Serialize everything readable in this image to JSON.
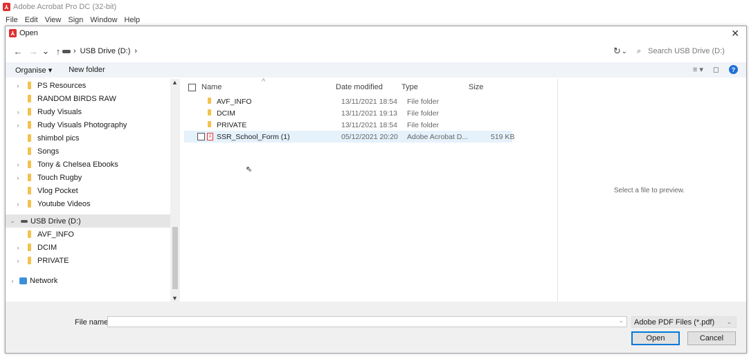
{
  "app": {
    "title": "Adobe Acrobat Pro DC (32-bit)",
    "menu": [
      "File",
      "Edit",
      "View",
      "Sign",
      "Window",
      "Help"
    ]
  },
  "dialog": {
    "title": "Open",
    "close_glyph": "✕",
    "nav": {
      "back": "←",
      "forward": "→",
      "recent": "⌄",
      "up": "↑"
    },
    "address": {
      "separator": "›",
      "location": "USB Drive (D:)",
      "tail_arrow": "›",
      "dropdown": "⌄"
    },
    "refresh_glyph": "↻",
    "search": {
      "icon": "⌕",
      "placeholder": "Search USB Drive (D:)"
    },
    "command_bar": {
      "organise": "Organise ▾",
      "new_folder": "New folder",
      "view_glyph": "≡ ▾",
      "pane_glyph": "◻",
      "help_glyph": "?"
    },
    "nav_pane": {
      "items": [
        {
          "label": "PS Resources",
          "expand": "›",
          "kind": "folder"
        },
        {
          "label": "RANDOM BIRDS RAW",
          "expand": "",
          "kind": "folder"
        },
        {
          "label": "Rudy Visuals",
          "expand": "›",
          "kind": "folder"
        },
        {
          "label": "Rudy Visuals Photography",
          "expand": "›",
          "kind": "folder"
        },
        {
          "label": "shimbol pics",
          "expand": "",
          "kind": "folder"
        },
        {
          "label": "Songs",
          "expand": "",
          "kind": "folder"
        },
        {
          "label": "Tony & Chelsea Ebooks",
          "expand": "›",
          "kind": "folder"
        },
        {
          "label": "Touch Rugby",
          "expand": "›",
          "kind": "folder"
        },
        {
          "label": "Vlog Pocket",
          "expand": "",
          "kind": "folder"
        },
        {
          "label": "Youtube Videos",
          "expand": "›",
          "kind": "folder"
        },
        {
          "label": "USB Drive (D:)",
          "expand": "⌄",
          "kind": "drive"
        },
        {
          "label": "AVF_INFO",
          "expand": "",
          "kind": "folder"
        },
        {
          "label": "DCIM",
          "expand": "›",
          "kind": "folder"
        },
        {
          "label": "PRIVATE",
          "expand": "›",
          "kind": "folder"
        },
        {
          "label": "Network",
          "expand": "›",
          "kind": "network"
        }
      ],
      "scroll_up": "▲",
      "scroll_down": "▼"
    },
    "file_list": {
      "columns": {
        "name": "Name",
        "date": "Date modified",
        "type": "Type",
        "size": "Size"
      },
      "sort_glyph": "^",
      "rows": [
        {
          "name": "AVF_INFO",
          "date": "13/11/2021 18:54",
          "type": "File folder",
          "size": "",
          "kind": "folder"
        },
        {
          "name": "DCIM",
          "date": "13/11/2021 19:13",
          "type": "File folder",
          "size": "",
          "kind": "folder"
        },
        {
          "name": "PRIVATE",
          "date": "13/11/2021 18:54",
          "type": "File folder",
          "size": "",
          "kind": "folder"
        },
        {
          "name": "SSR_School_Form (1)",
          "date": "05/12/2021 20:20",
          "type": "Adobe Acrobat D...",
          "size": "519 KB",
          "kind": "pdf"
        }
      ]
    },
    "preview_text": "Select a file to preview.",
    "bottom": {
      "file_name_label": "File name:",
      "file_name_value": "",
      "file_name_dd": "⌄",
      "file_type": "Adobe PDF Files (*.pdf)",
      "file_type_dd": "⌄",
      "open": "Open",
      "cancel": "Cancel"
    }
  }
}
